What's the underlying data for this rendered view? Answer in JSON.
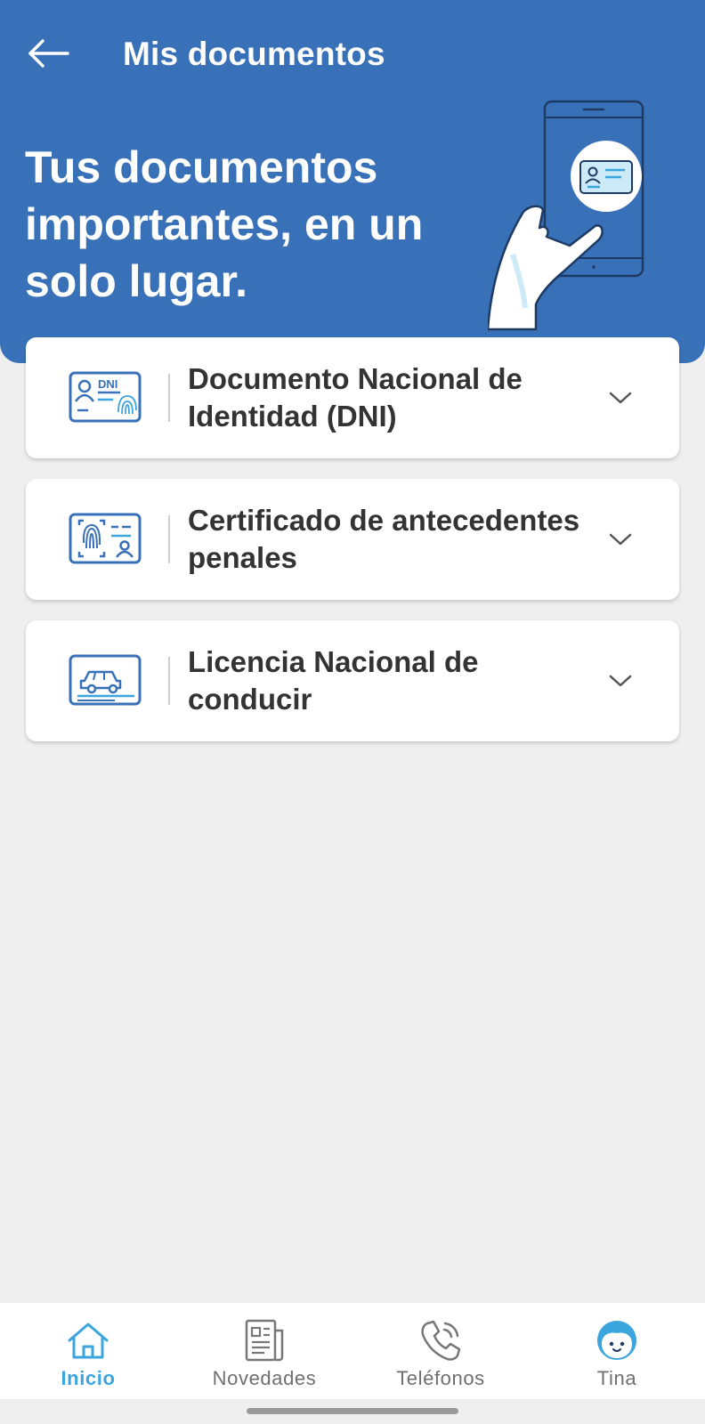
{
  "header": {
    "title": "Mis documentos",
    "hero_line1": "Tus documentos",
    "hero_line2": "importantes, en un",
    "hero_line3": "solo lugar."
  },
  "documents": [
    {
      "line1": "Documento Nacional de",
      "line2": "Identidad (DNI)",
      "icon": "dni-card-icon",
      "badge": "DNI"
    },
    {
      "line1": "Certificado de antecedentes",
      "line2": "penales",
      "icon": "fingerprint-certificate-icon"
    },
    {
      "line1": "Licencia Nacional de",
      "line2": "conducir",
      "icon": "driver-license-car-icon"
    }
  ],
  "bottom_nav": [
    {
      "label": "Inicio",
      "icon": "home-icon",
      "active": true
    },
    {
      "label": "Novedades",
      "icon": "newspaper-icon",
      "active": false
    },
    {
      "label": "Teléfonos",
      "icon": "phone-icon",
      "active": false
    },
    {
      "label": "Tina",
      "icon": "tina-avatar-icon",
      "active": false
    }
  ],
  "colors": {
    "primary": "#3971b9",
    "accent": "#3ba6dd",
    "background": "#efefef",
    "text": "#333333"
  }
}
